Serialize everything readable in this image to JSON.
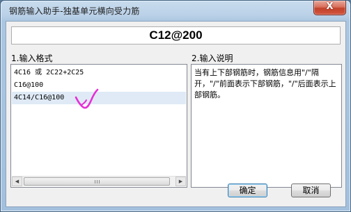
{
  "window": {
    "title": "钢筋输入助手-独基单元横向受力筋",
    "close_glyph": "X"
  },
  "result": {
    "value": "C12@200"
  },
  "format": {
    "label": "1.输入格式",
    "items": [
      "4C16 或 2C22+2C25",
      "C16@100",
      "4C14/C16@100"
    ],
    "selected_index": 2
  },
  "description": {
    "label": "2.输入说明",
    "text": "当有上下部钢筋时，钢筋信息用\"/\"隔开，\"/\"前面表示下部钢筋，\"/\"后面表示上部钢筋。"
  },
  "buttons": {
    "ok": "确定",
    "cancel": "取消"
  },
  "annotation": {
    "icon": "checkmark-scribble-icon",
    "color": "#e62fd6"
  },
  "colors": {
    "selection": "#dfeaf6",
    "frame": "#a3c0dd",
    "close": "#c2422b"
  }
}
